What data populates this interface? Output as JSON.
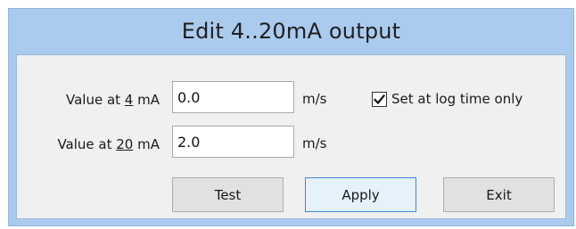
{
  "window": {
    "title": "Edit 4..20mA output"
  },
  "fields": [
    {
      "label_prefix": "Value at ",
      "label_mnemonic": "4",
      "label_suffix": " mA",
      "value": "0.0",
      "unit": "m/s"
    },
    {
      "label_prefix": "Value at ",
      "label_mnemonic": "20",
      "label_suffix": " mA",
      "value": "2.0",
      "unit": "m/s"
    }
  ],
  "options": {
    "set_at_log_time_label": "Set at log time only",
    "set_at_log_time_checked": true
  },
  "buttons": {
    "test": "Test",
    "apply": "Apply",
    "exit": "Exit"
  }
}
